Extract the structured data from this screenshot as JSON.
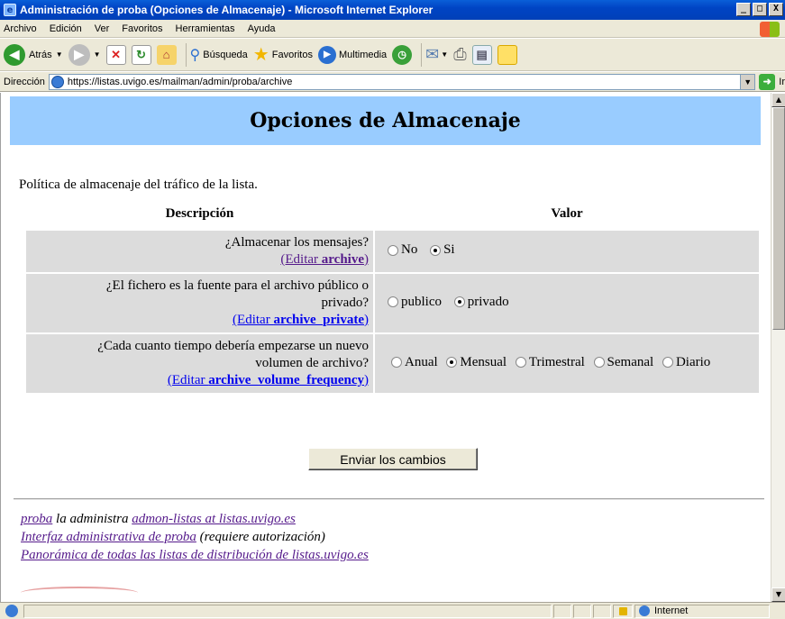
{
  "window": {
    "title": "Administración de proba (Opciones de Almacenaje) - Microsoft Internet Explorer",
    "controls": [
      "_",
      "□",
      "X"
    ]
  },
  "menubar": {
    "items": [
      "Archivo",
      "Edición",
      "Ver",
      "Favoritos",
      "Herramientas",
      "Ayuda"
    ]
  },
  "toolbar": {
    "back": "Atrás",
    "search": "Búsqueda",
    "favorites": "Favoritos",
    "multimedia": "Multimedia"
  },
  "address": {
    "label": "Dirección",
    "url": "https://listas.uvigo.es/mailman/admin/proba/archive",
    "go": "Ir"
  },
  "page": {
    "title": "Opciones de Almacenaje",
    "intro": "Política de almacenaje del tráfico de la lista.",
    "col_desc": "Descripción",
    "col_value": "Valor",
    "rows": [
      {
        "question": "¿Almacenar los mensajes?",
        "edit_prefix": "(Editar ",
        "edit_name": "archive",
        "edit_suffix": ")",
        "options": [
          "No",
          "Si"
        ],
        "selected": "Si"
      },
      {
        "question_line1": "¿El fichero es la fuente para el archivo público o",
        "question_line2": "privado?",
        "edit_prefix": "(Editar ",
        "edit_name": "archive_private",
        "edit_suffix": ")",
        "options": [
          "publico",
          "privado"
        ],
        "selected": "privado"
      },
      {
        "question_line1": "¿Cada cuanto tiempo debería empezarse un nuevo",
        "question_line2": "volumen de archivo?",
        "edit_prefix": "(Editar ",
        "edit_name": "archive_volume_frequency",
        "edit_suffix": ")",
        "options": [
          "Anual",
          "Mensual",
          "Trimestral",
          "Semanal",
          "Diario"
        ],
        "selected": "Mensual"
      }
    ],
    "submit": "Enviar los cambios",
    "footer": {
      "list_link": "proba",
      "administered_by": " la administra ",
      "admin_link": "admon-listas at listas.uvigo.es",
      "admin_iface_link": "Interfaz administrativa de proba",
      "auth_note": " (requiere autorización)",
      "overview_link": "Panorámica de todas las listas de distribución de listas.uvigo.es"
    }
  },
  "status": {
    "zone": "Internet"
  }
}
